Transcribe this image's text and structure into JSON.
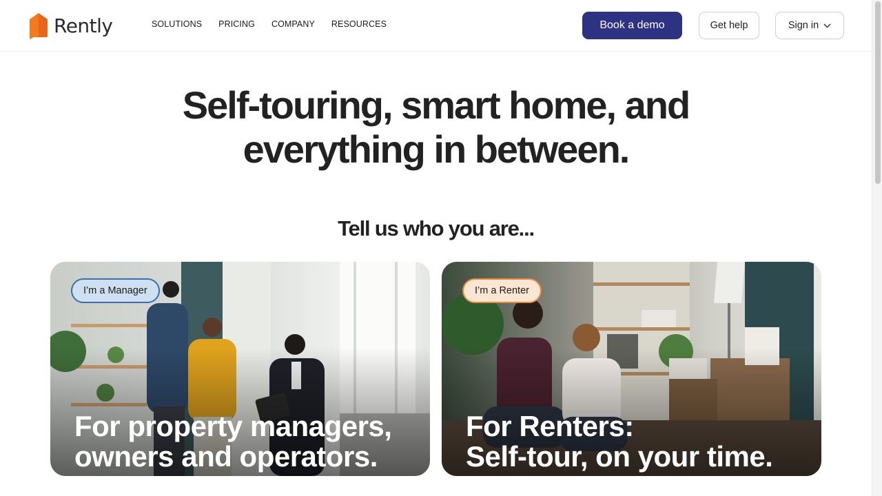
{
  "header": {
    "logo_text": "Rently",
    "nav": [
      "SOLUTIONS",
      "PRICING",
      "COMPANY",
      "RESOURCES"
    ],
    "book_demo_label": "Book a demo",
    "get_help_label": "Get help",
    "sign_in_label": "Sign in"
  },
  "hero": {
    "title_line1": "Self-touring, smart home, and",
    "title_line2": "everything in between.",
    "subtitle": "Tell us who you are..."
  },
  "cards": [
    {
      "pill": "I’m a Manager",
      "heading_line1": "For property managers,",
      "heading_line2": "owners and operators."
    },
    {
      "pill": "I’m a Renter",
      "heading_line1": "For Renters:",
      "heading_line2": "Self-tour, on your time."
    }
  ],
  "colors": {
    "brand_orange": "#f47a20",
    "primary_button": "#2e3283",
    "manager_pill_border": "#3a6ea8",
    "renter_pill_border": "#e8893d"
  }
}
